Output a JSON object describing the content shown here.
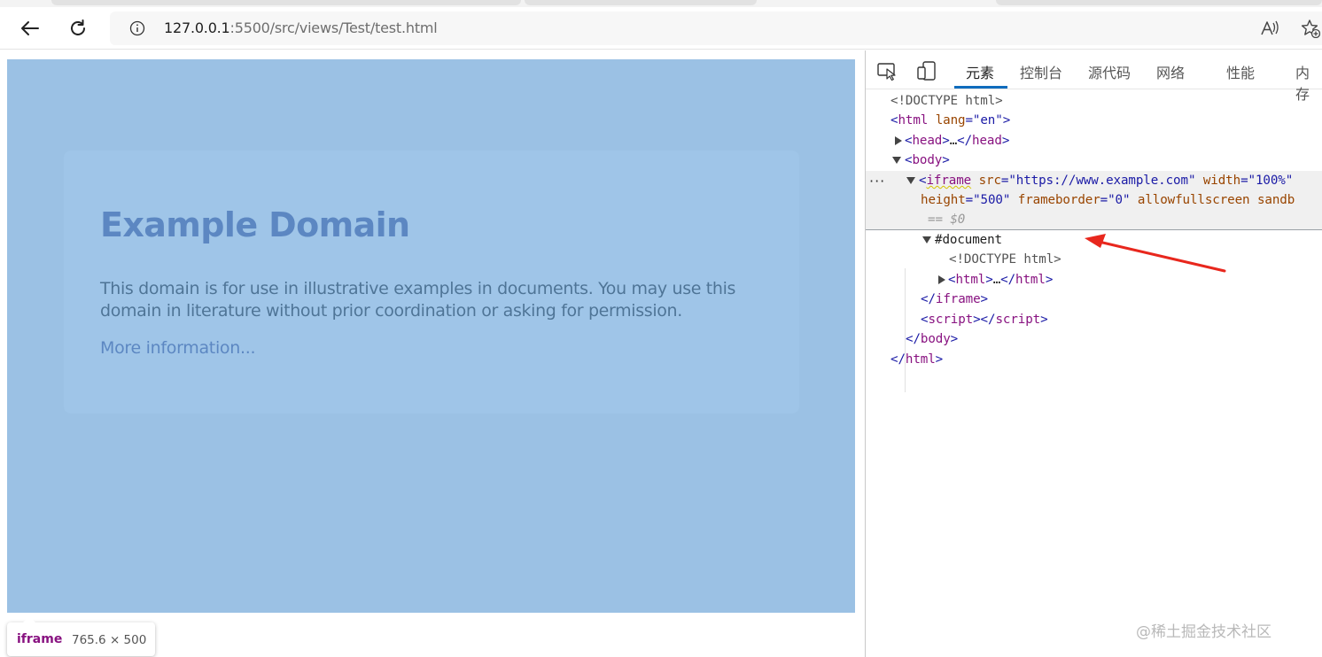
{
  "browser": {
    "url_host": "127.0.0.1",
    "url_path": ":5500/src/views/Test/test.html",
    "icons": {
      "back": "arrow-left-icon",
      "reload": "refresh-icon",
      "info": "info-circle-icon",
      "read_aloud": "read-aloud-icon",
      "favorite": "star-plus-icon"
    }
  },
  "page": {
    "iframe_content": {
      "title": "Example Domain",
      "paragraph": "This domain is for use in illustrative examples in documents. You may use this domain in literature without prior coordination or asking for permission.",
      "link": "More information..."
    },
    "tooltip": {
      "tag": "iframe",
      "size": "765.6 × 500"
    },
    "colors": {
      "highlight": "#9dc0e4",
      "title": "#38488f"
    }
  },
  "devtools": {
    "tabs": [
      {
        "label": "元素",
        "active": true
      },
      {
        "label": "控制台",
        "active": false
      },
      {
        "label": "源代码",
        "active": false
      },
      {
        "label": "网络",
        "active": false
      },
      {
        "label": "性能",
        "active": false
      },
      {
        "label": "内存",
        "active": false
      }
    ],
    "icons": {
      "inspect": "inspect-element-icon",
      "device": "device-toolbar-icon"
    },
    "dom": {
      "doctype": "<!DOCTYPE html>",
      "html_open_tag": "html",
      "html_lang_attr": "lang",
      "html_lang_value": "\"en\"",
      "head": "head",
      "head_ellipsis": "…",
      "body": "body",
      "iframe_tag": "iframe",
      "iframe_src_attr": "src",
      "iframe_src_value": "\"https://www.example.com\"",
      "iframe_width_attr": "width",
      "iframe_width_value": "\"100%\"",
      "iframe_height_attr": "height",
      "iframe_height_value": "\"500\"",
      "iframe_frameborder_attr": "frameborder",
      "iframe_frameborder_value": "\"0\"",
      "iframe_allowfullscreen_attr": "allowfullscreen",
      "iframe_sandbox_partial": "sandb",
      "selected_marker": "== $0",
      "document_node": "#document",
      "inner_doctype": "<!DOCTYPE html>",
      "inner_html": "html",
      "script": "script"
    },
    "row_ellipsis": "···"
  },
  "watermark": "@稀土掘金技术社区"
}
